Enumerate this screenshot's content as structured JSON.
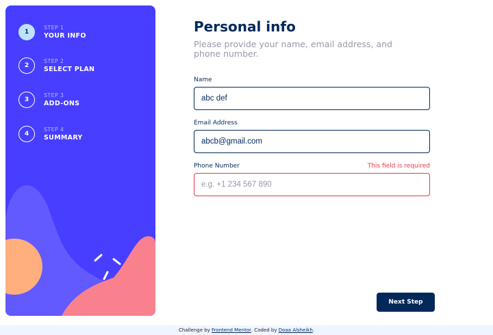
{
  "sidebar": {
    "steps": [
      {
        "number": "1",
        "sub": "STEP 1",
        "title": "YOUR INFO",
        "active": true
      },
      {
        "number": "2",
        "sub": "STEP 2",
        "title": "SELECT PLAN",
        "active": false
      },
      {
        "number": "3",
        "sub": "STEP 3",
        "title": "ADD-ONS",
        "active": false
      },
      {
        "number": "4",
        "sub": "STEP 4",
        "title": "SUMMARY",
        "active": false
      }
    ]
  },
  "main": {
    "title": "Personal info",
    "subtitle": "Please provide your name, email address, and phone number.",
    "fields": {
      "name": {
        "label": "Name",
        "value": "abc def",
        "placeholder": "",
        "error": ""
      },
      "email": {
        "label": "Email Address",
        "value": "abcb@gmail.com",
        "placeholder": "",
        "error": ""
      },
      "phone": {
        "label": "Phone Number",
        "value": "",
        "placeholder": "e.g. +1 234 567 890",
        "error": "This field is required"
      }
    },
    "next_label": "Next Step"
  },
  "footer": {
    "challenge_prefix": "Challenge by",
    "challenge_link": "Frontend Mentor",
    "coded_prefix": ". Coded by",
    "coded_link": "Doaa Alsheikh",
    "end": "."
  },
  "colors": {
    "sidebar_bg": "#483eff",
    "marine_blue": "#02295a",
    "active_step": "#bee2fd",
    "error_red": "#ed3548",
    "blob_orange": "#ffaf7e",
    "blob_pink": "#f9818e",
    "blob_violet": "#6259ff",
    "footer_bg": "#eef5ff"
  }
}
